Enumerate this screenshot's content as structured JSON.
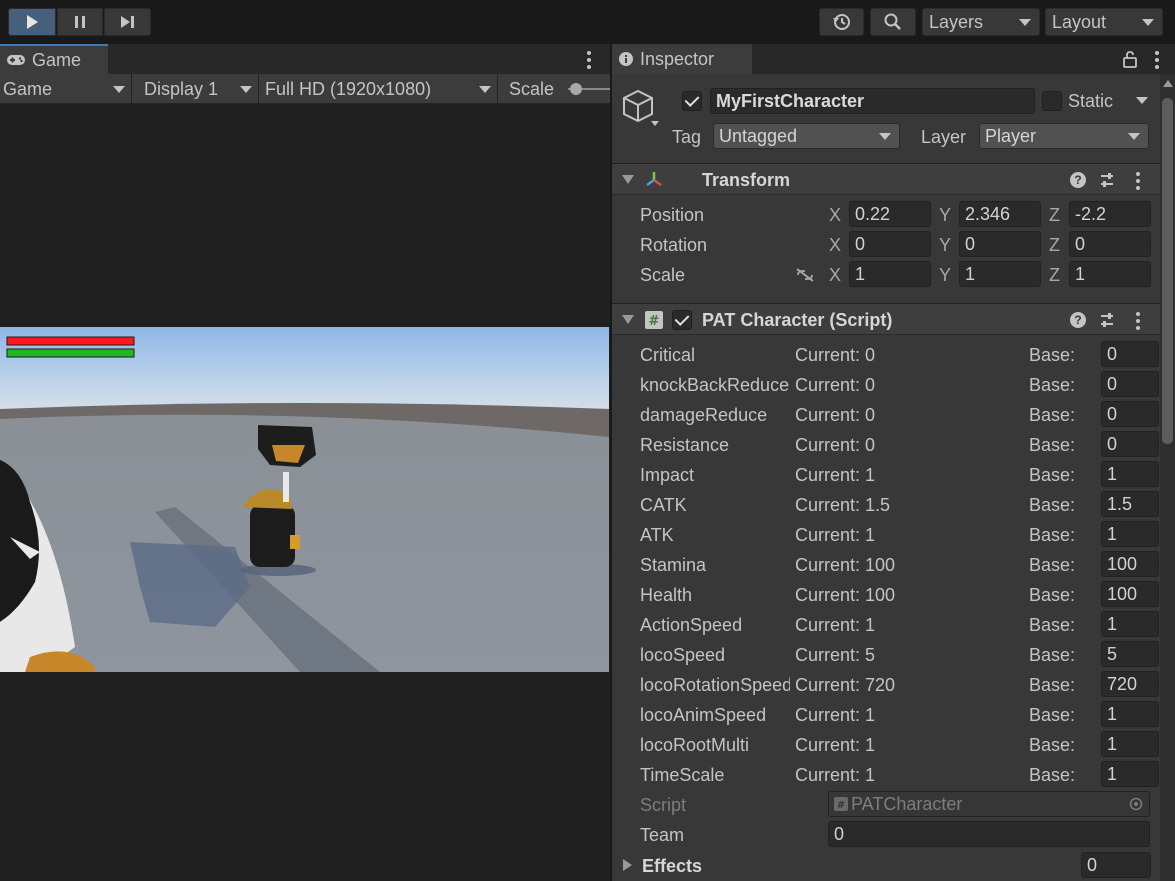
{
  "toolbar": {
    "layers_label": "Layers",
    "layout_label": "Layout"
  },
  "game": {
    "tab_label": "Game",
    "mode": "Game",
    "display": "Display 1",
    "resolution": "Full HD (1920x1080)",
    "scale_label": "Scale"
  },
  "inspector": {
    "tab_label": "Inspector",
    "object": {
      "name": "MyFirstCharacter",
      "active": true,
      "static_label": "Static",
      "tag_label": "Tag",
      "tag": "Untagged",
      "layer_label": "Layer",
      "layer": "Player"
    },
    "transform": {
      "title": "Transform",
      "rows": [
        {
          "label": "Position",
          "x": "0.22",
          "y": "2.346",
          "z": "-2.2"
        },
        {
          "label": "Rotation",
          "x": "0",
          "y": "0",
          "z": "0"
        },
        {
          "label": "Scale",
          "x": "1",
          "y": "1",
          "z": "1"
        }
      ],
      "axis_x": "X",
      "axis_y": "Y",
      "axis_z": "Z"
    },
    "script_component": {
      "title": "PAT Character (Script)",
      "current_prefix": "Current:",
      "base_label": "Base:",
      "rows": [
        {
          "label": "Critical",
          "current": "Current: 0",
          "base": "0"
        },
        {
          "label": "knockBackReduce",
          "current": "Current: 0",
          "base": "0"
        },
        {
          "label": "damageReduce",
          "current": "Current: 0",
          "base": "0"
        },
        {
          "label": "Resistance",
          "current": "Current: 0",
          "base": "0"
        },
        {
          "label": "Impact",
          "current": "Current: 1",
          "base": "1"
        },
        {
          "label": "CATK",
          "current": "Current: 1.5",
          "base": "1.5"
        },
        {
          "label": "ATK",
          "current": "Current: 1",
          "base": "1"
        },
        {
          "label": "Stamina",
          "current": "Current: 100",
          "base": "100"
        },
        {
          "label": "Health",
          "current": "Current: 100",
          "base": "100"
        },
        {
          "label": "ActionSpeed",
          "current": "Current: 1",
          "base": "1"
        },
        {
          "label": "locoSpeed",
          "current": "Current: 5",
          "base": "5"
        },
        {
          "label": "locoRotationSpeed",
          "current": "Current: 720",
          "base": "720"
        },
        {
          "label": "locoAnimSpeed",
          "current": "Current: 1",
          "base": "1"
        },
        {
          "label": "locoRootMulti",
          "current": "Current: 1",
          "base": "1"
        },
        {
          "label": "TimeScale",
          "current": "Current: 1",
          "base": "1"
        }
      ],
      "script_label": "Script",
      "script_value": "PATCharacter",
      "team_label": "Team",
      "team_value": "0",
      "effects_label": "Effects",
      "effects_value": "0"
    }
  },
  "colors": {
    "health_bar": "#ff1a1a",
    "stamina_bar": "#22b822",
    "play_active": "#46607c"
  }
}
